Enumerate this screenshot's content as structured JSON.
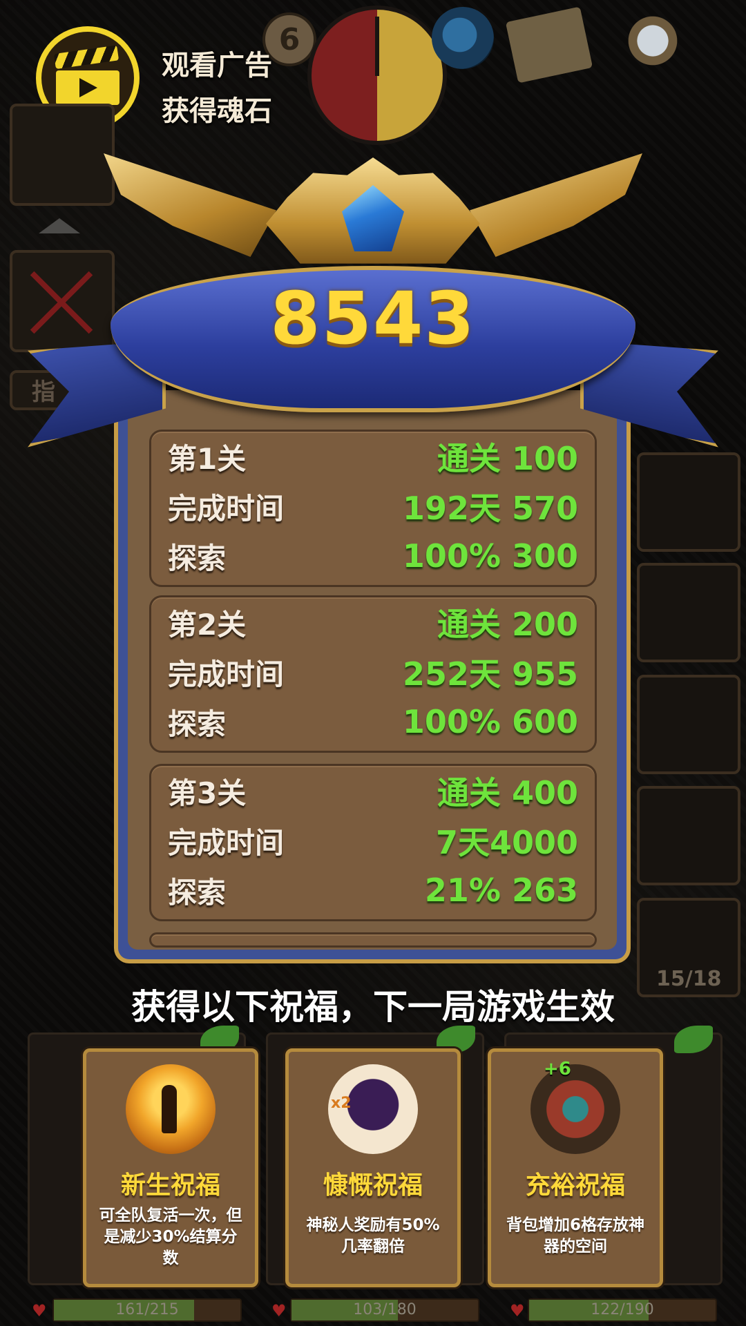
{
  "top_bar": {
    "day_badge": "6",
    "ad_button": {
      "line1": "观看广告",
      "line2": "获得魂石"
    }
  },
  "left_sidebar": {
    "label_partial": "指"
  },
  "right_sidebar": {
    "count": "15/18"
  },
  "score": "8543",
  "levels": [
    {
      "name": "第1关",
      "clear_label": "通关  100",
      "time_label": "完成时间",
      "time_value": "192天 570",
      "explore_label": "探索",
      "explore_value": "100% 300"
    },
    {
      "name": "第2关",
      "clear_label": "通关 200",
      "time_label": "完成时间",
      "time_value": "252天 955",
      "explore_label": "探索",
      "explore_value": "100% 600"
    },
    {
      "name": "第3关",
      "clear_label": "通关 400",
      "time_label": "完成时间",
      "time_value": "7天4000",
      "explore_label": "探索",
      "explore_value": "21% 263"
    }
  ],
  "blessings_title": "获得以下祝福，下一局游戏生效",
  "blessings": [
    {
      "name": "新生祝福",
      "desc": "可全队复活一次，但是减少30%结算分数",
      "icon": "rebirth-icon"
    },
    {
      "name": "慷慨祝福",
      "desc": "神秘人奖励有50%几率翻倍",
      "icon": "hooded-stranger-icon"
    },
    {
      "name": "充裕祝福",
      "desc": "背包增加6格存放神器的空间",
      "icon": "backpack-icon",
      "badge": "+6"
    }
  ],
  "hp_bars": [
    {
      "text": "161/215",
      "ratio": 0.75
    },
    {
      "text": "103/180",
      "ratio": 0.57
    },
    {
      "text": "122/190",
      "ratio": 0.64
    }
  ],
  "colors": {
    "score_gold": "#ffd93a",
    "value_green": "#6ee43c",
    "ribbon_blue": "#2d3f9e",
    "panel_brown": "#7a5f42",
    "ad_yellow": "#f2d52c"
  }
}
